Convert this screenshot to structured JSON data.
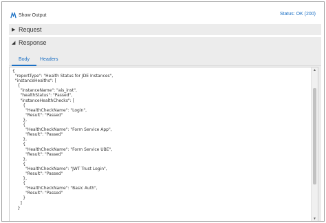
{
  "header": {
    "show_output_label": "Show Output",
    "status_text": "Status: OK (200)",
    "status_color": "#1a6fc4",
    "icon": "output-icon"
  },
  "sections": {
    "request_label": "Request",
    "response_label": "Response"
  },
  "tabs": {
    "body_label": "Body",
    "headers_label": "Headers",
    "active": "Body"
  },
  "response_body": {
    "lines": [
      "{",
      "  \"reportType\": \"Health Status for JDE Instances\",",
      "  \"instanceHealths\": [",
      "    {",
      "      \"instanceName\": \"ais_inst\",",
      "      \"healthStatus\": \"Passed\",",
      "      \"instanceHealthChecks\": [",
      "        {",
      "          \"HealthCheckName\": \"Login\",",
      "          \"Result\": \"Passed\"",
      "        },",
      "        {",
      "          \"HealthCheckName\": \"Form Service App\",",
      "          \"Result\": \"Passed\"",
      "        },",
      "        {",
      "          \"HealthCheckName\": \"Form Service UBE\",",
      "          \"Result\": \"Passed\"",
      "        },",
      "        {",
      "          \"HealthCheckName\": \"JWT Trust Login\",",
      "          \"Result\": \"Passed\"",
      "        },",
      "        {",
      "          \"HealthCheckName\": \"Basic Auth\",",
      "          \"Result\": \"Passed\"",
      "        }",
      "      ]",
      "    }"
    ]
  }
}
